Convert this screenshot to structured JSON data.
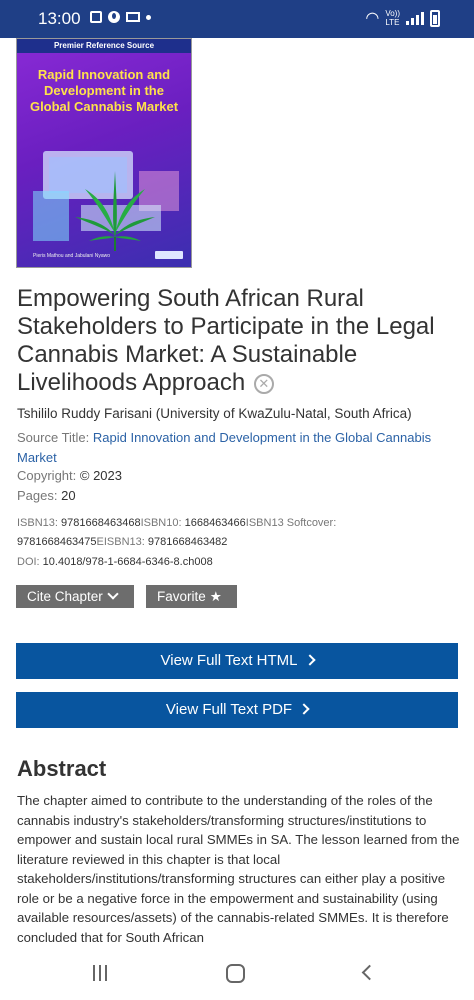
{
  "status_bar": {
    "time": "13:00",
    "left_icons": [
      "gallery-icon",
      "vodafone-icon",
      "mail-icon",
      "dot-icon"
    ],
    "network": "LTE",
    "voice_label": "Vo))",
    "right_icons": [
      "wifi-icon",
      "volte-icon",
      "signal-icon",
      "battery-icon"
    ]
  },
  "cover": {
    "band": "Premier Reference Source",
    "title": "Rapid Innovation and Development in the Global Cannabis Market",
    "authors": "Pieris Mathou and Jabulani Nyawo",
    "publisher": "IGI Global"
  },
  "chapter": {
    "title": "Empowering South African Rural Stakeholders to Participate in the Legal Cannabis Market: A Sustainable Livelihoods Approach",
    "author": "Tshililo Ruddy Farisani (University of KwaZulu-Natal, South Africa)",
    "source_label": "Source Title: ",
    "source_title": "Rapid Innovation and Development in the Global Cannabis Market",
    "copyright_label": "Copyright: ",
    "copyright_value": "© 2023",
    "pages_label": "Pages: ",
    "pages_value": "20",
    "isbn13_label": "ISBN13: ",
    "isbn13_value": "9781668463468",
    "isbn10_label": "ISBN10: ",
    "isbn10_value": "1668463466",
    "isbn13_softcover_label": "ISBN13 Softcover: ",
    "isbn13_softcover_value": "9781668463475",
    "eisbn13_label": "EISBN13: ",
    "eisbn13_value": "9781668463482",
    "doi_label": "DOI: ",
    "doi_value": "10.4018/978-1-6684-6346-8.ch008"
  },
  "actions": {
    "cite_label": "Cite Chapter",
    "favorite_label": "Favorite",
    "view_html_label": "View Full Text HTML",
    "view_pdf_label": "View Full Text PDF"
  },
  "abstract": {
    "heading": "Abstract",
    "text": "The chapter aimed to contribute to the understanding of the roles of the cannabis industry's stakeholders/transforming structures/institutions to empower and sustain local rural SMMEs in SA. The lesson learned from the literature reviewed in this chapter is that local stakeholders/institutions/transforming structures can either play a positive role or be a negative force in the empowerment and sustainability (using available resources/assets) of the cannabis-related SMMEs. It is therefore concluded that for South African"
  },
  "nav": {
    "icons": [
      "recent-apps-icon",
      "home-icon",
      "back-icon"
    ]
  },
  "colors": {
    "status_bar": "#1f3f86",
    "primary_button": "#08559f",
    "secondary_button": "#6d6d6d",
    "link": "#2b62a6",
    "cover_purple": "#7b26cc",
    "cover_title": "#ffe24a"
  }
}
